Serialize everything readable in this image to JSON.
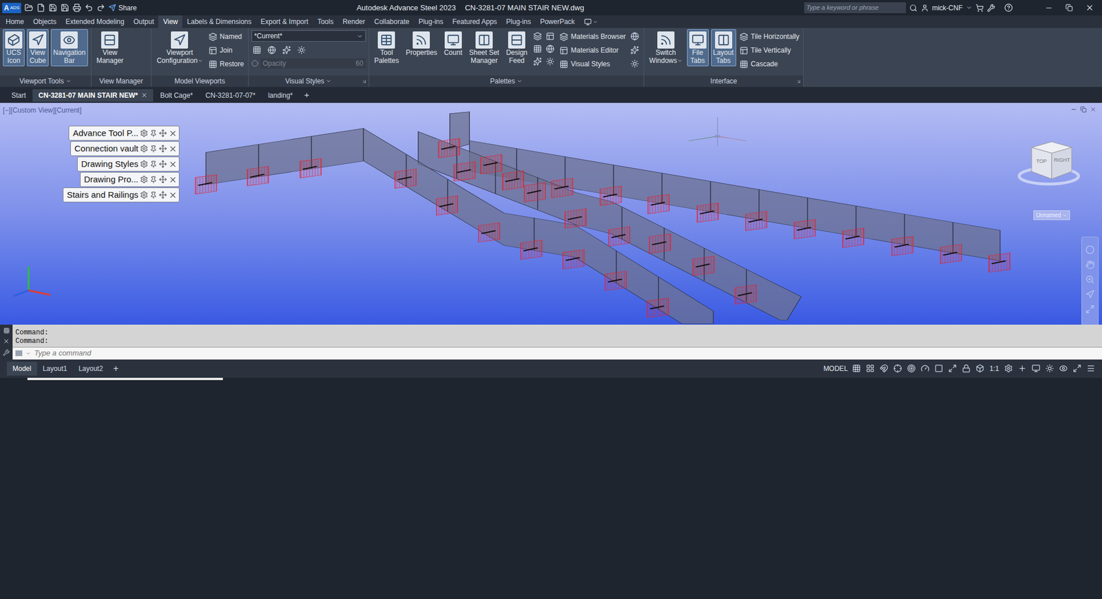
{
  "titlebar": {
    "logo": "A",
    "badge": "ADS",
    "share": "Share",
    "app": "Autodesk Advance Steel 2023",
    "file": "CN-3281-07 MAIN STAIR NEW.dwg",
    "search_placeholder": "Type a keyword or phrase",
    "user": "mick-CNF"
  },
  "menu_tabs": [
    {
      "label": "Home",
      "selected": false
    },
    {
      "label": "Objects",
      "selected": false
    },
    {
      "label": "Extended Modeling",
      "selected": false
    },
    {
      "label": "Output",
      "selected": false
    },
    {
      "label": "View",
      "selected": true
    },
    {
      "label": "Labels & Dimensions",
      "selected": false
    },
    {
      "label": "Export & Import",
      "selected": false
    },
    {
      "label": "Tools",
      "selected": false
    },
    {
      "label": "Render",
      "selected": false
    },
    {
      "label": "Collaborate",
      "selected": false
    },
    {
      "label": "Plug-ins",
      "selected": false
    },
    {
      "label": "Featured Apps",
      "selected": false
    },
    {
      "label": "Plug-ins",
      "selected": false
    },
    {
      "label": "PowerPack",
      "selected": false
    }
  ],
  "ribbon": [
    {
      "kind": "buttons",
      "title": "Viewport Tools",
      "dropdown": true,
      "launcher": false,
      "large": [
        {
          "lines": [
            "UCS",
            "Icon"
          ],
          "selected": true,
          "dropdown": false
        },
        {
          "lines": [
            "View",
            "Cube"
          ],
          "selected": true,
          "dropdown": false
        },
        {
          "lines": [
            "Navigation",
            "Bar"
          ],
          "selected": true,
          "dropdown": false
        }
      ],
      "small": []
    },
    {
      "kind": "buttons",
      "title": "View Manager",
      "dropdown": false,
      "launcher": false,
      "large": [
        {
          "lines": [
            "View",
            "Manager"
          ],
          "selected": false,
          "dropdown": false
        }
      ],
      "small": []
    },
    {
      "kind": "buttons",
      "title": "Model Viewports",
      "dropdown": false,
      "launcher": false,
      "large": [
        {
          "lines": [
            "Viewport",
            "Configuration"
          ],
          "selected": false,
          "dropdown": true
        }
      ],
      "small": [
        "Named",
        "Join",
        "Restore"
      ]
    },
    {
      "kind": "visual-styles",
      "title": "Visual Styles",
      "dropdown": true,
      "launcher": true,
      "style": "*Current*",
      "opacity_placeholder": "Opacity",
      "opacity_value": "60",
      "opacity_disabled": true,
      "large": [],
      "small": []
    },
    {
      "kind": "palettes",
      "title": "Palettes",
      "dropdown": true,
      "launcher": false,
      "large": [
        {
          "lines": [
            "Tool",
            "Palettes"
          ],
          "selected": false,
          "dropdown": false
        },
        {
          "lines": [
            "Properties"
          ],
          "selected": false,
          "dropdown": false
        },
        {
          "lines": [
            "Count"
          ],
          "selected": false,
          "dropdown": false
        },
        {
          "lines": [
            "Sheet Set",
            "Manager"
          ],
          "selected": false,
          "dropdown": false
        },
        {
          "lines": [
            "Design",
            "Feed"
          ],
          "selected": false,
          "dropdown": false
        }
      ],
      "small": [
        "Materials Browser",
        "Materials Editor",
        "Visual Styles"
      ]
    },
    {
      "kind": "buttons",
      "title": "Interface",
      "dropdown": false,
      "launcher": true,
      "large": [
        {
          "lines": [
            "Switch",
            "Windows"
          ],
          "selected": false,
          "dropdown": true
        },
        {
          "lines": [
            "File",
            "Tabs"
          ],
          "selected": true,
          "dropdown": false
        },
        {
          "lines": [
            "Layout",
            "Tabs"
          ],
          "selected": true,
          "dropdown": false
        }
      ],
      "small": [
        "Tile Horizontally",
        "Tile Vertically",
        "Cascade"
      ]
    }
  ],
  "file_tabs": [
    {
      "label": "Start",
      "selected": false,
      "closable": false
    },
    {
      "label": "CN-3281-07 MAIN STAIR NEW*",
      "selected": true,
      "closable": true
    },
    {
      "label": "Bolt Cage*",
      "selected": false,
      "closable": false
    },
    {
      "label": "CN-3281-07-07*",
      "selected": false,
      "closable": false
    },
    {
      "label": "landing*",
      "selected": false,
      "closable": false
    }
  ],
  "file_tab_add": "+",
  "viewport": {
    "label": "[−][Custom View][Current]",
    "palettes": [
      "Advance Tool P...",
      "Connection vault",
      "Drawing Styles",
      "Drawing Pro...",
      "Stairs and Railings"
    ],
    "viewcube_top": "TOP",
    "viewcube_right": "RIGHT",
    "view_name": "Unnamed"
  },
  "command": {
    "history": [
      "Command:",
      "Command:"
    ],
    "placeholder": "Type a command"
  },
  "layout_tabs": [
    {
      "label": "Model",
      "selected": true
    },
    {
      "label": "Layout1",
      "selected": false
    },
    {
      "label": "Layout2",
      "selected": false
    }
  ],
  "layout_add": "+",
  "status": {
    "space": "MODEL",
    "scale": "1:1"
  }
}
